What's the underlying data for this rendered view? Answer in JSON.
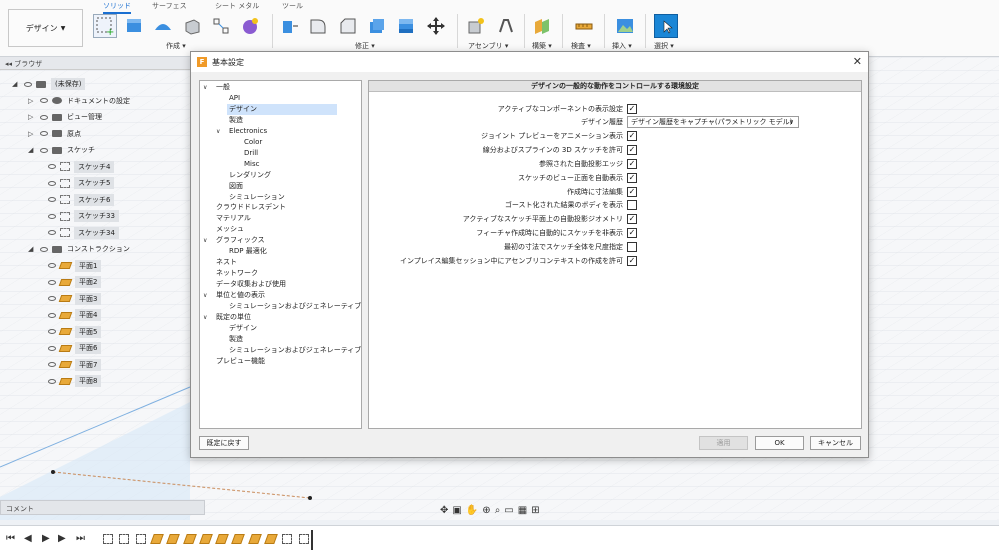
{
  "toolbar": {
    "workspace_label": "デザイン",
    "tabs": [
      "ソリッド",
      "サーフェス",
      "シート メタル",
      "ツール"
    ],
    "groups": [
      "作成",
      "修正",
      "アセンブリ",
      "構築",
      "検査",
      "挿入",
      "選択"
    ]
  },
  "browser": {
    "title": "ブラウザ",
    "items": [
      {
        "label": "(未保存)",
        "kind": "root"
      },
      {
        "label": "ドキュメントの設定",
        "kind": "gear"
      },
      {
        "label": "ビュー管理",
        "kind": "folder"
      },
      {
        "label": "原点",
        "kind": "folder"
      },
      {
        "label": "スケッチ",
        "kind": "folder"
      },
      {
        "label": "スケッチ4",
        "kind": "sketch"
      },
      {
        "label": "スケッチ5",
        "kind": "sketch"
      },
      {
        "label": "スケッチ6",
        "kind": "sketch"
      },
      {
        "label": "スケッチ33",
        "kind": "sketch"
      },
      {
        "label": "スケッチ34",
        "kind": "sketch"
      },
      {
        "label": "コンストラクション",
        "kind": "folder"
      },
      {
        "label": "平面1",
        "kind": "plane"
      },
      {
        "label": "平面2",
        "kind": "plane"
      },
      {
        "label": "平面3",
        "kind": "plane"
      },
      {
        "label": "平面4",
        "kind": "plane"
      },
      {
        "label": "平面5",
        "kind": "plane"
      },
      {
        "label": "平面6",
        "kind": "plane"
      },
      {
        "label": "平面7",
        "kind": "plane"
      },
      {
        "label": "平面8",
        "kind": "plane"
      }
    ]
  },
  "comment_label": "コメント",
  "dialog": {
    "title": "基本設定",
    "logo": "F",
    "header": "デザインの一般的な動作をコントロールする環境設定",
    "tree": [
      {
        "label": "一般",
        "level": 0,
        "expander": "v"
      },
      {
        "label": "API",
        "level": 2
      },
      {
        "label": "デザイン",
        "level": 2,
        "selected": true
      },
      {
        "label": "製造",
        "level": 2
      },
      {
        "label": "Electronics",
        "level": 2,
        "expander": "v"
      },
      {
        "label": "Color",
        "level": 3
      },
      {
        "label": "Drill",
        "level": 3
      },
      {
        "label": "Misc",
        "level": 3
      },
      {
        "label": "レンダリング",
        "level": 2
      },
      {
        "label": "図面",
        "level": 2
      },
      {
        "label": "シミュレーション",
        "level": 2
      },
      {
        "label": "クラウドドレスデント",
        "level": 0
      },
      {
        "label": "マテリアル",
        "level": 0
      },
      {
        "label": "メッシュ",
        "level": 0
      },
      {
        "label": "グラフィックス",
        "level": 0,
        "expander": "v"
      },
      {
        "label": "RDP 最適化",
        "level": 2
      },
      {
        "label": "ネスト",
        "level": 0
      },
      {
        "label": "ネットワーク",
        "level": 0
      },
      {
        "label": "データ収集および使用",
        "level": 0
      },
      {
        "label": "単位と値の表示",
        "level": 0,
        "expander": "v"
      },
      {
        "label": "シミュレーションおよびジェネレーティブ デザイン",
        "level": 2
      },
      {
        "label": "既定の単位",
        "level": 0,
        "expander": "v"
      },
      {
        "label": "デザイン",
        "level": 2
      },
      {
        "label": "製造",
        "level": 2
      },
      {
        "label": "シミュレーションおよびジェネレーティブ デザイン",
        "level": 2
      },
      {
        "label": "プレビュー機能",
        "level": 0
      }
    ],
    "settings": [
      {
        "label": "アクティブなコンポーネントの表示設定",
        "type": "checkbox",
        "checked": true
      },
      {
        "label": "デザイン履歴",
        "type": "dropdown",
        "value": "デザイン履歴をキャプチャ(パラメトリック モデル)"
      },
      {
        "label": "ジョイント プレビューをアニメーション表示",
        "type": "checkbox",
        "checked": true
      },
      {
        "label": "線分およびスプラインの 3D スケッチを許可",
        "type": "checkbox",
        "checked": true
      },
      {
        "label": "参照された自動投影エッジ",
        "type": "checkbox",
        "checked": true
      },
      {
        "label": "スケッチのビュー正面を自動表示",
        "type": "checkbox",
        "checked": true
      },
      {
        "label": "作成時に寸法編集",
        "type": "checkbox",
        "checked": true
      },
      {
        "label": "ゴースト化された結果のボディを表示",
        "type": "checkbox",
        "checked": false
      },
      {
        "label": "アクティブなスケッチ平面上の自動投影ジオメトリ",
        "type": "checkbox",
        "checked": true
      },
      {
        "label": "フィーチャ作成時に自動的にスケッチを非表示",
        "type": "checkbox",
        "checked": true
      },
      {
        "label": "最初の寸法でスケッチ全体を尺度指定",
        "type": "checkbox",
        "checked": false
      },
      {
        "label": "インプレイス編集セッション中にアセンブリコンテキストの作成を許可",
        "type": "checkbox",
        "checked": true
      }
    ],
    "buttons": {
      "reset": "既定に戻す",
      "apply": "適用",
      "ok": "OK",
      "cancel": "キャンセル"
    }
  }
}
